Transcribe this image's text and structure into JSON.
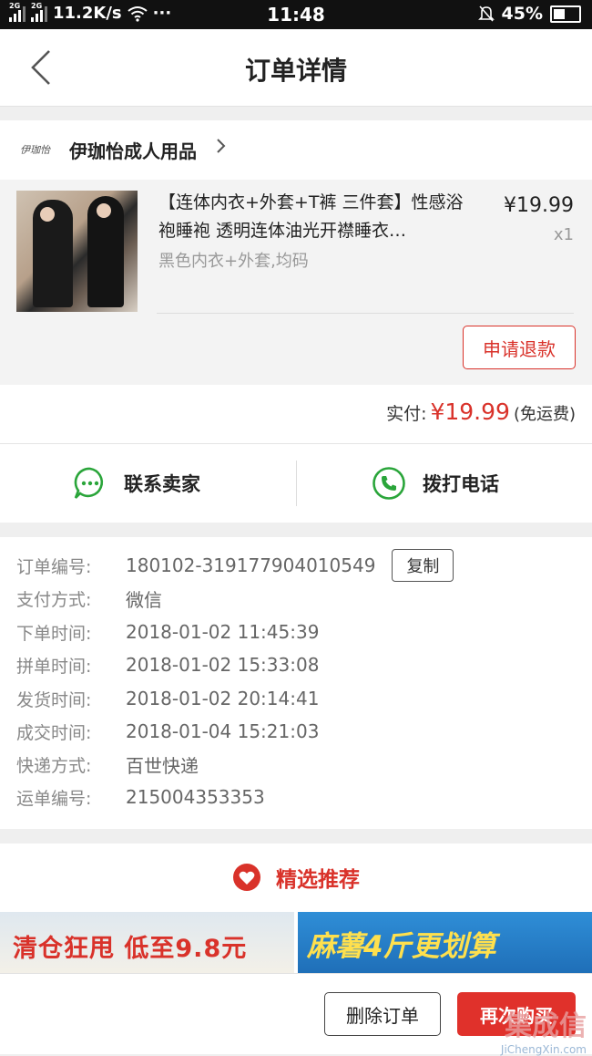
{
  "status_bar": {
    "signal1": "2G",
    "signal2": "2G",
    "speed": "11.2K/s",
    "dots": "···",
    "time": "11:48",
    "battery": "45%"
  },
  "nav": {
    "title": "订单详情"
  },
  "shop": {
    "logo_text": "伊珈怡",
    "name": "伊珈怡成人用品"
  },
  "product": {
    "title": "【连体内衣+外套+T裤 三件套】性感浴袍睡袍 透明连体油光开襟睡衣…",
    "spec": "黑色内衣+外套,均码",
    "price": "¥19.99",
    "qty": "x1",
    "refund_label": "申请退款"
  },
  "payment": {
    "label": "实付:",
    "amount": "¥19.99",
    "fee_note": "(免运费)"
  },
  "contact": {
    "seller_label": "联系卖家",
    "phone_label": "拨打电话"
  },
  "order_info": {
    "rows": [
      {
        "key": "订单编号:",
        "value": "180102-319177904010549"
      },
      {
        "key": "支付方式:",
        "value": "微信"
      },
      {
        "key": "下单时间:",
        "value": "2018-01-02 11:45:39"
      },
      {
        "key": "拼单时间:",
        "value": "2018-01-02 15:33:08"
      },
      {
        "key": "发货时间:",
        "value": "2018-01-02 20:14:41"
      },
      {
        "key": "成交时间:",
        "value": "2018-01-04 15:21:03"
      },
      {
        "key": "快递方式:",
        "value": "百世快递"
      },
      {
        "key": "运单编号:",
        "value": "215004353353"
      }
    ],
    "copy_label": "复制"
  },
  "recommend": {
    "title": "精选推荐"
  },
  "banners": {
    "left_text": "清仓狂甩 低至9.8元",
    "right_text": "麻薯4斤更划算"
  },
  "actions": {
    "delete_label": "删除订单",
    "rebuy_label": "再次购买"
  },
  "watermark": {
    "main": "集成信",
    "sub": "JiChengXin.com"
  },
  "colors": {
    "accent": "#d9322a",
    "green": "#2aa53a"
  }
}
